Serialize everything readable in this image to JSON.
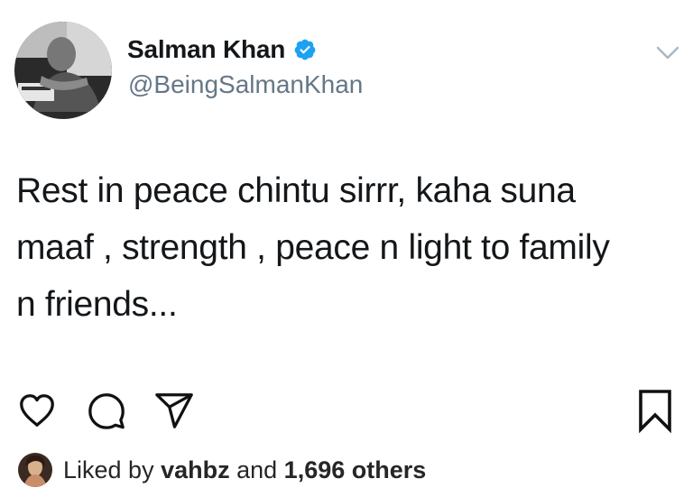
{
  "tweet": {
    "display_name": "Salman Khan",
    "handle": "@BeingSalmanKhan",
    "verified": true,
    "text_lines": [
      "Rest in peace chintu sirrr,  kaha suna",
      "maaf , strength , peace n light to family",
      "n friends..."
    ]
  },
  "post": {
    "likes": {
      "prefix": "Liked by ",
      "user": "vahbz",
      "middle": " and ",
      "count": "1,696 others"
    }
  },
  "icons": {
    "verified": "verified-badge-icon",
    "caret": "chevron-down-icon",
    "like": "heart-icon",
    "comment": "comment-icon",
    "share": "send-icon",
    "save": "bookmark-icon"
  },
  "colors": {
    "verified": "#1da1f2",
    "handle": "#657786",
    "text": "#14171a"
  }
}
